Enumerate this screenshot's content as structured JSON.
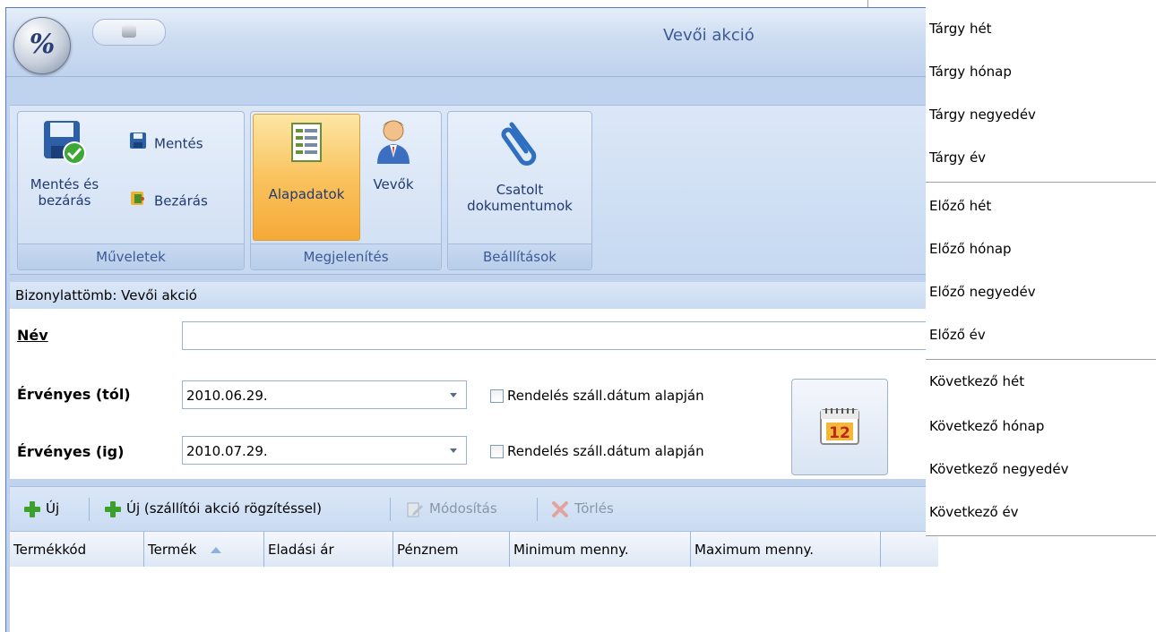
{
  "window": {
    "title": "Vevői akció"
  },
  "ribbon": {
    "groups": [
      {
        "label": "Műveletek"
      },
      {
        "label": "Megjelenítés"
      },
      {
        "label": "Beállítások"
      }
    ],
    "save_close_label": "Mentés és bezárás",
    "save_label": "Mentés",
    "close_label": "Bezárás",
    "basic_data_label": "Alapadatok",
    "customers_label": "Vevők",
    "attached_docs_label": "Csatolt dokumentumok"
  },
  "doc_block": {
    "text": "Bizonylattömb: Vevői akció"
  },
  "form": {
    "name_label": "Név",
    "name_value": "",
    "valid_from_label": "Érvényes (tól)",
    "valid_from_value": "2010.06.29.",
    "valid_to_label": "Érvényes (ig)",
    "valid_to_value": "2010.07.29.",
    "checkbox_from_label": "Rendelés száll.dátum alapján",
    "checkbox_to_label": "Rendelés száll.dátum alapján",
    "calendar_icon_text": "12"
  },
  "toolbar": {
    "new_label": "Új",
    "new_supplier_label": "Új (szállítói akció rögzítéssel)",
    "edit_label": "Módosítás",
    "delete_label": "Törlés"
  },
  "grid": {
    "columns": [
      "Termékkód",
      "Termék",
      "Eladási ár",
      "Pénznem",
      "Minimum menny.",
      "Maximum menny."
    ]
  },
  "menu": {
    "items": [
      "Tárgy hét",
      "Tárgy hónap",
      "Tárgy negyedév",
      "Tárgy év",
      "Előző hét",
      "Előző hónap",
      "Előző negyedév",
      "Előző év",
      "Következő hét",
      "Következő hónap",
      "Következő negyedév",
      "Következő év"
    ]
  },
  "colors": {
    "ribbon_bg": "#c6d9f1",
    "active_button": "#f9c35e",
    "title_text": "#3d5a95",
    "add_icon": "#3ea02c"
  }
}
